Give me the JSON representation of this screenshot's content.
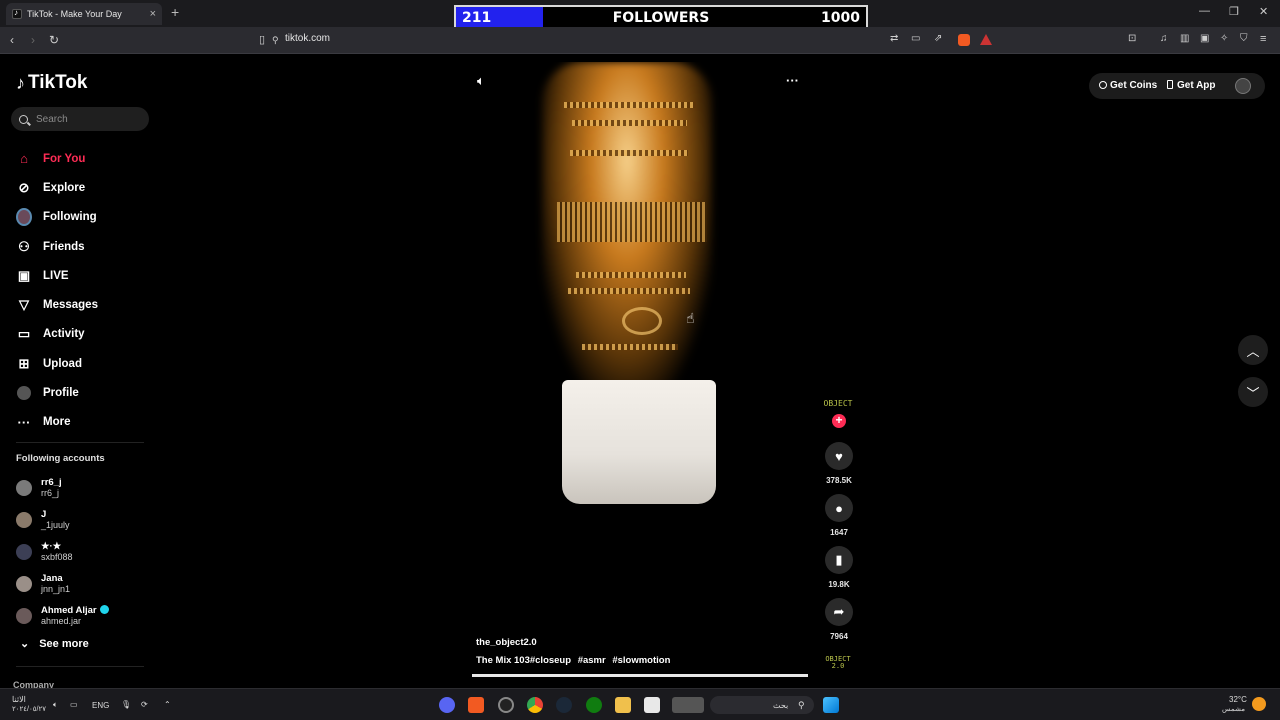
{
  "browser": {
    "tab_title": "TikTok - Make Your Day",
    "tab_close": "×",
    "new_tab": "+",
    "url": "tiktok.com",
    "win_min": "—",
    "win_max": "❐",
    "win_close": "✕"
  },
  "overlay": {
    "current": "211",
    "label": "FOLLOWERS",
    "goal": "1000",
    "progress_fraction": 0.211
  },
  "sidebar": {
    "brand": "TikTok",
    "search_placeholder": "Search",
    "menu": [
      {
        "label": "For You",
        "icon": "home-icon",
        "active": true
      },
      {
        "label": "Explore",
        "icon": "compass-icon"
      },
      {
        "label": "Following",
        "icon": "avatar-ring-icon"
      },
      {
        "label": "Friends",
        "icon": "friends-icon"
      },
      {
        "label": "LIVE",
        "icon": "live-icon"
      },
      {
        "label": "Messages",
        "icon": "send-icon"
      },
      {
        "label": "Activity",
        "icon": "inbox-icon"
      },
      {
        "label": "Upload",
        "icon": "upload-icon"
      },
      {
        "label": "Profile",
        "icon": "profile-icon"
      },
      {
        "label": "More",
        "icon": "more-icon"
      }
    ],
    "following_title": "Following accounts",
    "accounts": [
      {
        "name": "rr6_j",
        "handle": "rr6_j"
      },
      {
        "name": "J",
        "handle": "_1juuly"
      },
      {
        "name": "★·★",
        "handle": "sxbf088"
      },
      {
        "name": "Jana",
        "handle": "jnn_jn1"
      },
      {
        "name": "Ahmed Aljar",
        "handle": "ahmed.jar",
        "verified": true
      }
    ],
    "see_more": "See more",
    "company": "Company"
  },
  "video": {
    "author": "the_object2.0",
    "caption": "The Mix 103",
    "hashtags": [
      "#closeup",
      "#asmr",
      "#slowmotion"
    ],
    "progress_fraction": 1.0,
    "creator_logo": "OBJECT",
    "creator_logo_sub": "2.0"
  },
  "actions": {
    "follow": "+",
    "likes": "378.5K",
    "comments": "1647",
    "saves": "19.8K",
    "shares": "7964"
  },
  "header": {
    "get_coins": "Get Coins",
    "get_app": "Get App"
  },
  "taskbar": {
    "weather": "32°C",
    "weather_desc": "مشمس",
    "time": "الاثنا",
    "date": "٢٠٢٤/٠٥/٢٧",
    "lang": "ENG",
    "search_placeholder": "بحث"
  },
  "colors": {
    "accent": "#fe2c55",
    "follower_bar": "#2222ee",
    "verified": "#20d5ec"
  }
}
